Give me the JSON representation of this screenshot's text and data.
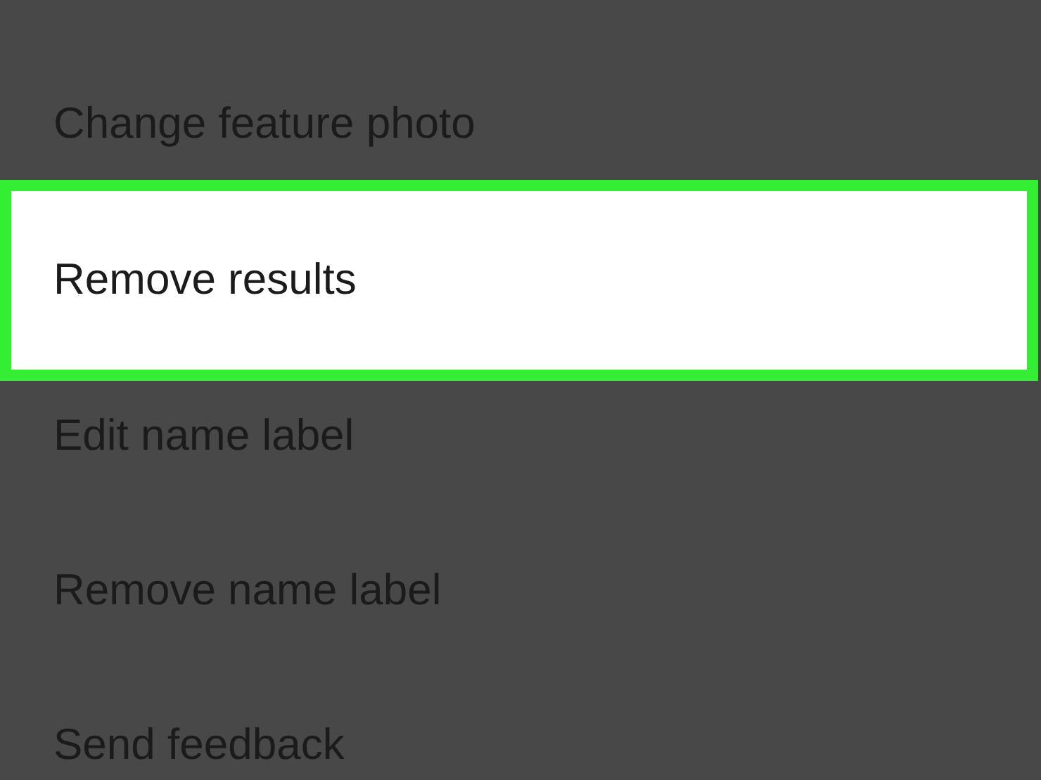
{
  "menu": {
    "items": [
      {
        "label": "Change feature photo",
        "selected": false
      },
      {
        "label": "Remove results",
        "selected": true
      },
      {
        "label": "Edit name label",
        "selected": false
      },
      {
        "label": "Remove name label",
        "selected": false
      },
      {
        "label": "Send feedback",
        "selected": false
      }
    ]
  }
}
